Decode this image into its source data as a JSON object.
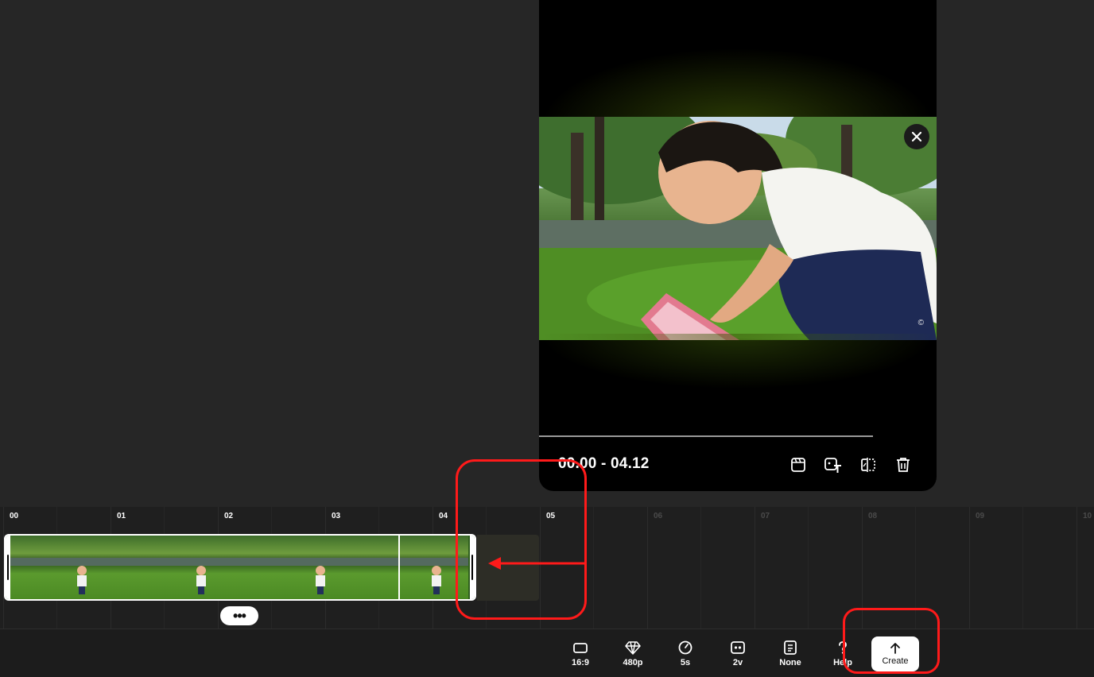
{
  "preview": {
    "timecode": "00.00 - 04.12",
    "watermark": "©",
    "tools": [
      {
        "name": "storyboard-icon"
      },
      {
        "name": "text-style-icon"
      },
      {
        "name": "compare-icon"
      },
      {
        "name": "trash-icon"
      }
    ]
  },
  "timeline": {
    "ticks": [
      "00",
      "01",
      "02",
      "03",
      "04",
      "05",
      "06",
      "07",
      "08",
      "09",
      "10"
    ],
    "more_label": "•••"
  },
  "toolbar": {
    "items": [
      {
        "label": "16:9",
        "icon": "aspect-ratio-icon"
      },
      {
        "label": "480p",
        "icon": "diamond-quality-icon"
      },
      {
        "label": "5s",
        "icon": "clock-icon"
      },
      {
        "label": "2v",
        "icon": "variants-icon"
      },
      {
        "label": "None",
        "icon": "document-icon"
      },
      {
        "label": "Help",
        "icon": "help-icon"
      }
    ],
    "create_label": "Create"
  },
  "colors": {
    "background": "#262626",
    "annotation": "#ff1a1a",
    "accent": "#ffffff"
  }
}
